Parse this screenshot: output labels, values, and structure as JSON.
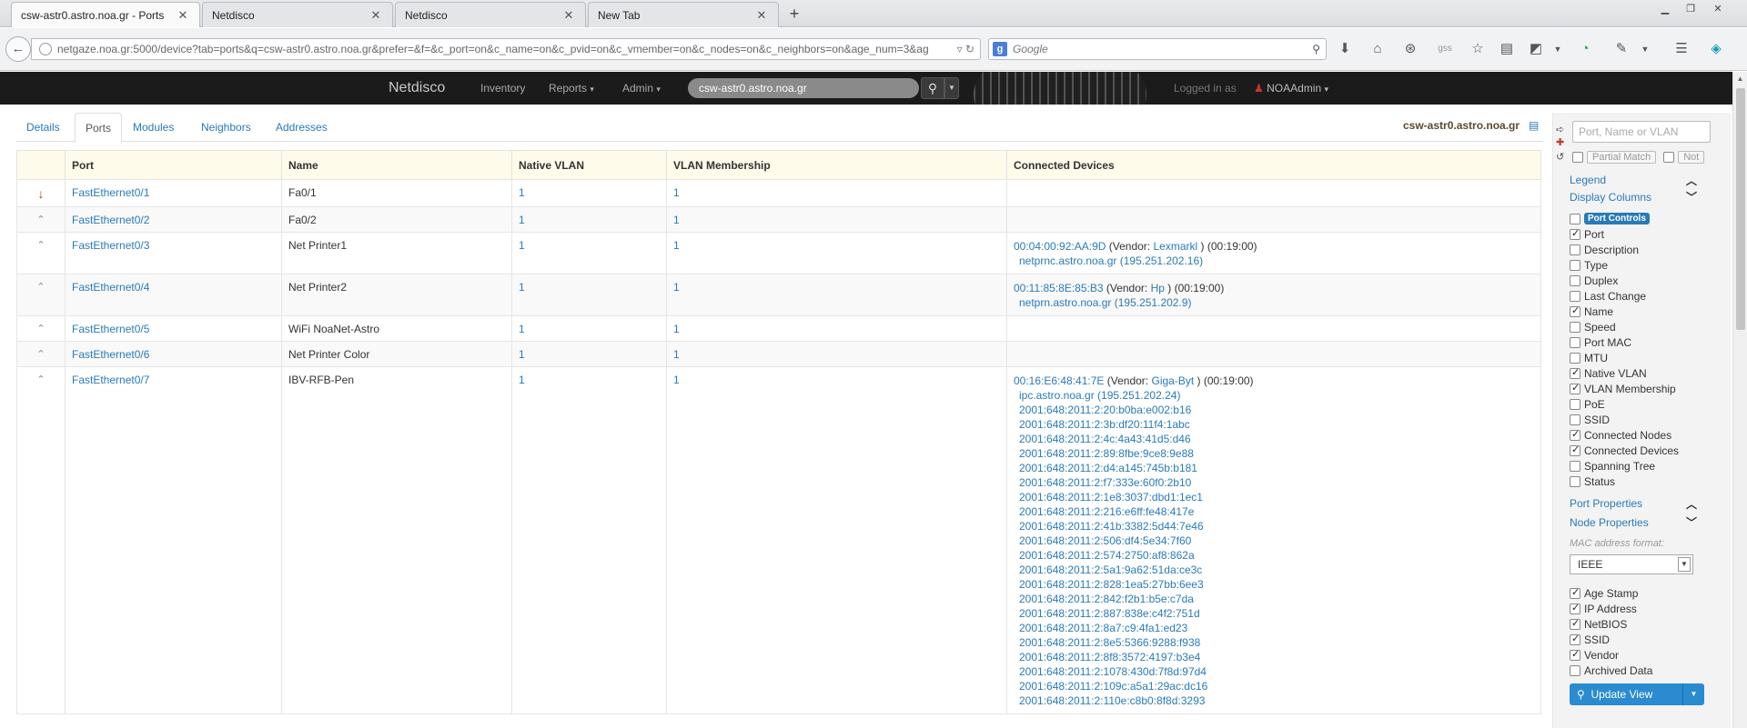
{
  "browser": {
    "tabs": [
      {
        "label": "csw-astr0.astro.noa.gr   - Ports",
        "active": true
      },
      {
        "label": "Netdisco",
        "active": false
      },
      {
        "label": "Netdisco",
        "active": false
      },
      {
        "label": "New Tab",
        "active": false
      }
    ],
    "new_tab": "+",
    "url": "netgaze.noa.gr:5000/device?tab=ports&q=csw-astr0.astro.noa.gr&prefer=&f=&c_port=on&c_name=on&c_pvid=on&c_vmember=on&c_nodes=on&c_neighbors=on&age_num=3&ag",
    "search_placeholder": "Google"
  },
  "app": {
    "brand": "Netdisco",
    "nav": {
      "inventory": "Inventory",
      "reports": "Reports",
      "admin": "Admin"
    },
    "search_value": "csw-astr0.astro.noa.gr",
    "logged_in_label": "Logged in as",
    "user": "NOAAdmin"
  },
  "page_tabs": [
    "Details",
    "Ports",
    "Modules",
    "Neighbors",
    "Addresses"
  ],
  "device_name": "csw-astr0.astro.noa.gr",
  "table": {
    "headers": [
      "Port",
      "Name",
      "Native VLAN",
      "VLAN Membership",
      "Connected Devices"
    ],
    "rows": [
      {
        "state": "down",
        "port": "FastEthernet0/1",
        "name": "Fa0/1",
        "native": "1",
        "member": "1",
        "devices": []
      },
      {
        "state": "up",
        "port": "FastEthernet0/2",
        "name": "Fa0/2",
        "native": "1",
        "member": "1",
        "devices": []
      },
      {
        "state": "up",
        "port": "FastEthernet0/3",
        "name": "Net Printer1",
        "native": "1",
        "member": "1",
        "devices": [
          {
            "mac": "00:04:00:92:AA:9D",
            "vendor_prefix": "(Vendor:",
            "vendor": "Lexmarkl",
            "age": ") (00:19:00)",
            "subs": [
              "netprnc.astro.noa.gr (195.251.202.16)"
            ]
          }
        ]
      },
      {
        "state": "up",
        "port": "FastEthernet0/4",
        "name": "Net Printer2",
        "native": "1",
        "member": "1",
        "devices": [
          {
            "mac": "00:11:85:8E:85:B3",
            "vendor_prefix": "(Vendor:",
            "vendor": "Hp",
            "age": ") (00:19:00)",
            "subs": [
              "netprn.astro.noa.gr (195.251.202.9)"
            ]
          }
        ]
      },
      {
        "state": "up",
        "port": "FastEthernet0/5",
        "name": "WiFi NoaNet-Astro",
        "native": "1",
        "member": "1",
        "devices": []
      },
      {
        "state": "up",
        "port": "FastEthernet0/6",
        "name": "Net Printer Color",
        "native": "1",
        "member": "1",
        "devices": []
      },
      {
        "state": "up",
        "port": "FastEthernet0/7",
        "name": "IBV-RFB-Pen",
        "native": "1",
        "member": "1",
        "devices": [
          {
            "mac": "00:16:E6:48:41:7E",
            "vendor_prefix": "(Vendor:",
            "vendor": "Giga-Byt",
            "age": ") (00:19:00)",
            "subs": [
              "ipc.astro.noa.gr (195.251.202.24)",
              "2001:648:2011:2:20:b0ba:e002:b16",
              "2001:648:2011:2:3b:df20:11f4:1abc",
              "2001:648:2011:2:4c:4a43:41d5:d46",
              "2001:648:2011:2:89:8fbe:9ce8:9e88",
              "2001:648:2011:2:d4:a145:745b:b181",
              "2001:648:2011:2:f7:333e:60f0:2b10",
              "2001:648:2011:2:1e8:3037:dbd1:1ec1",
              "2001:648:2011:2:216:e6ff:fe48:417e",
              "2001:648:2011:2:41b:3382:5d44:7e46",
              "2001:648:2011:2:506:df4:5e34:7f60",
              "2001:648:2011:2:574:2750:af8:862a",
              "2001:648:2011:2:5a1:9a62:51da:ce3c",
              "2001:648:2011:2:828:1ea5:27bb:6ee3",
              "2001:648:2011:2:842:f2b1:b5e:c7da",
              "2001:648:2011:2:887:838e:c4f2:751d",
              "2001:648:2011:2:8a7:c9:4fa1:ed23",
              "2001:648:2011:2:8e5:5366:9288:f938",
              "2001:648:2011:2:8f8:3572:4197:b3e4",
              "2001:648:2011:2:1078:430d:7f8d:97d4",
              "2001:648:2011:2:109c:a5a1:29ac:dc16",
              "2001:648:2011:2:110e:c8b0:8f8d:3293"
            ]
          }
        ]
      }
    ]
  },
  "sidebar": {
    "query_placeholder": "Port, Name or VLAN",
    "partial_match": "Partial Match",
    "not_label": "Not",
    "legend": "Legend",
    "display_columns": "Display Columns",
    "columns": [
      {
        "label": "Port Controls",
        "checked": false,
        "badge": true
      },
      {
        "label": "Port",
        "checked": true
      },
      {
        "label": "Description",
        "checked": false
      },
      {
        "label": "Type",
        "checked": false
      },
      {
        "label": "Duplex",
        "checked": false
      },
      {
        "label": "Last Change",
        "checked": false
      },
      {
        "label": "Name",
        "checked": true
      },
      {
        "label": "Speed",
        "checked": false
      },
      {
        "label": "Port MAC",
        "checked": false
      },
      {
        "label": "MTU",
        "checked": false
      },
      {
        "label": "Native VLAN",
        "checked": true
      },
      {
        "label": "VLAN Membership",
        "checked": true
      },
      {
        "label": "PoE",
        "checked": false
      },
      {
        "label": "SSID",
        "checked": false
      },
      {
        "label": "Connected Nodes",
        "checked": true
      },
      {
        "label": "Connected Devices",
        "checked": true
      },
      {
        "label": "Spanning Tree",
        "checked": false
      },
      {
        "label": "Status",
        "checked": false
      }
    ],
    "port_properties": "Port Properties",
    "node_properties": "Node Properties",
    "mac_format_label": "MAC address format:",
    "mac_format_value": "IEEE",
    "node_options": [
      {
        "label": "Age Stamp",
        "checked": true
      },
      {
        "label": "IP Address",
        "checked": true
      },
      {
        "label": "NetBIOS",
        "checked": true
      },
      {
        "label": "SSID",
        "checked": true
      },
      {
        "label": "Vendor",
        "checked": true
      },
      {
        "label": "Archived Data",
        "checked": false
      }
    ],
    "update_button": "Update View"
  }
}
